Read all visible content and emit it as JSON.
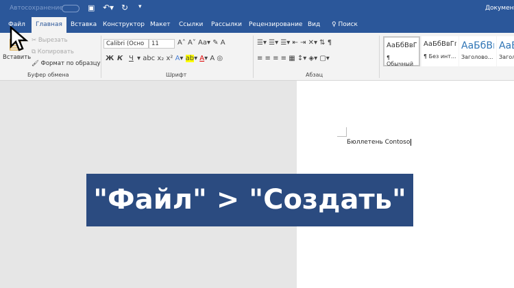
{
  "titlebar": {
    "autosave": "Автосохранение",
    "document": "Документ"
  },
  "tabs": [
    "Файл",
    "Главная",
    "Вставка",
    "Конструктор",
    "Макет",
    "Ссылки",
    "Рассылки",
    "Рецензирование",
    "Вид"
  ],
  "search": "Поиск",
  "clipboard": {
    "paste": "Вставить",
    "cut": "Вырезать",
    "copy": "Копировать",
    "format_painter": "Формат по образцу",
    "group": "Буфер обмена"
  },
  "font": {
    "name": "Calibri (Осно",
    "size": "11",
    "group": "Шрифт",
    "bold": "Ж",
    "italic": "К",
    "underline": "Ч"
  },
  "paragraph": {
    "group": "Абзац"
  },
  "styles": [
    {
      "preview": "АаБбВвГгД",
      "name": "¶ Обычный"
    },
    {
      "preview": "АаБбВвГгД",
      "name": "¶ Без инт..."
    },
    {
      "preview": "АаБбВı",
      "name": "Заголово..."
    },
    {
      "preview": "АаБб",
      "name": "Загол"
    }
  ],
  "document": {
    "text": "Бюллетень Contoso"
  },
  "banner": "\"Файл\" > \"Создать\"",
  "colors": {
    "accent": "#2b579a",
    "banner": "#2b4b80"
  }
}
